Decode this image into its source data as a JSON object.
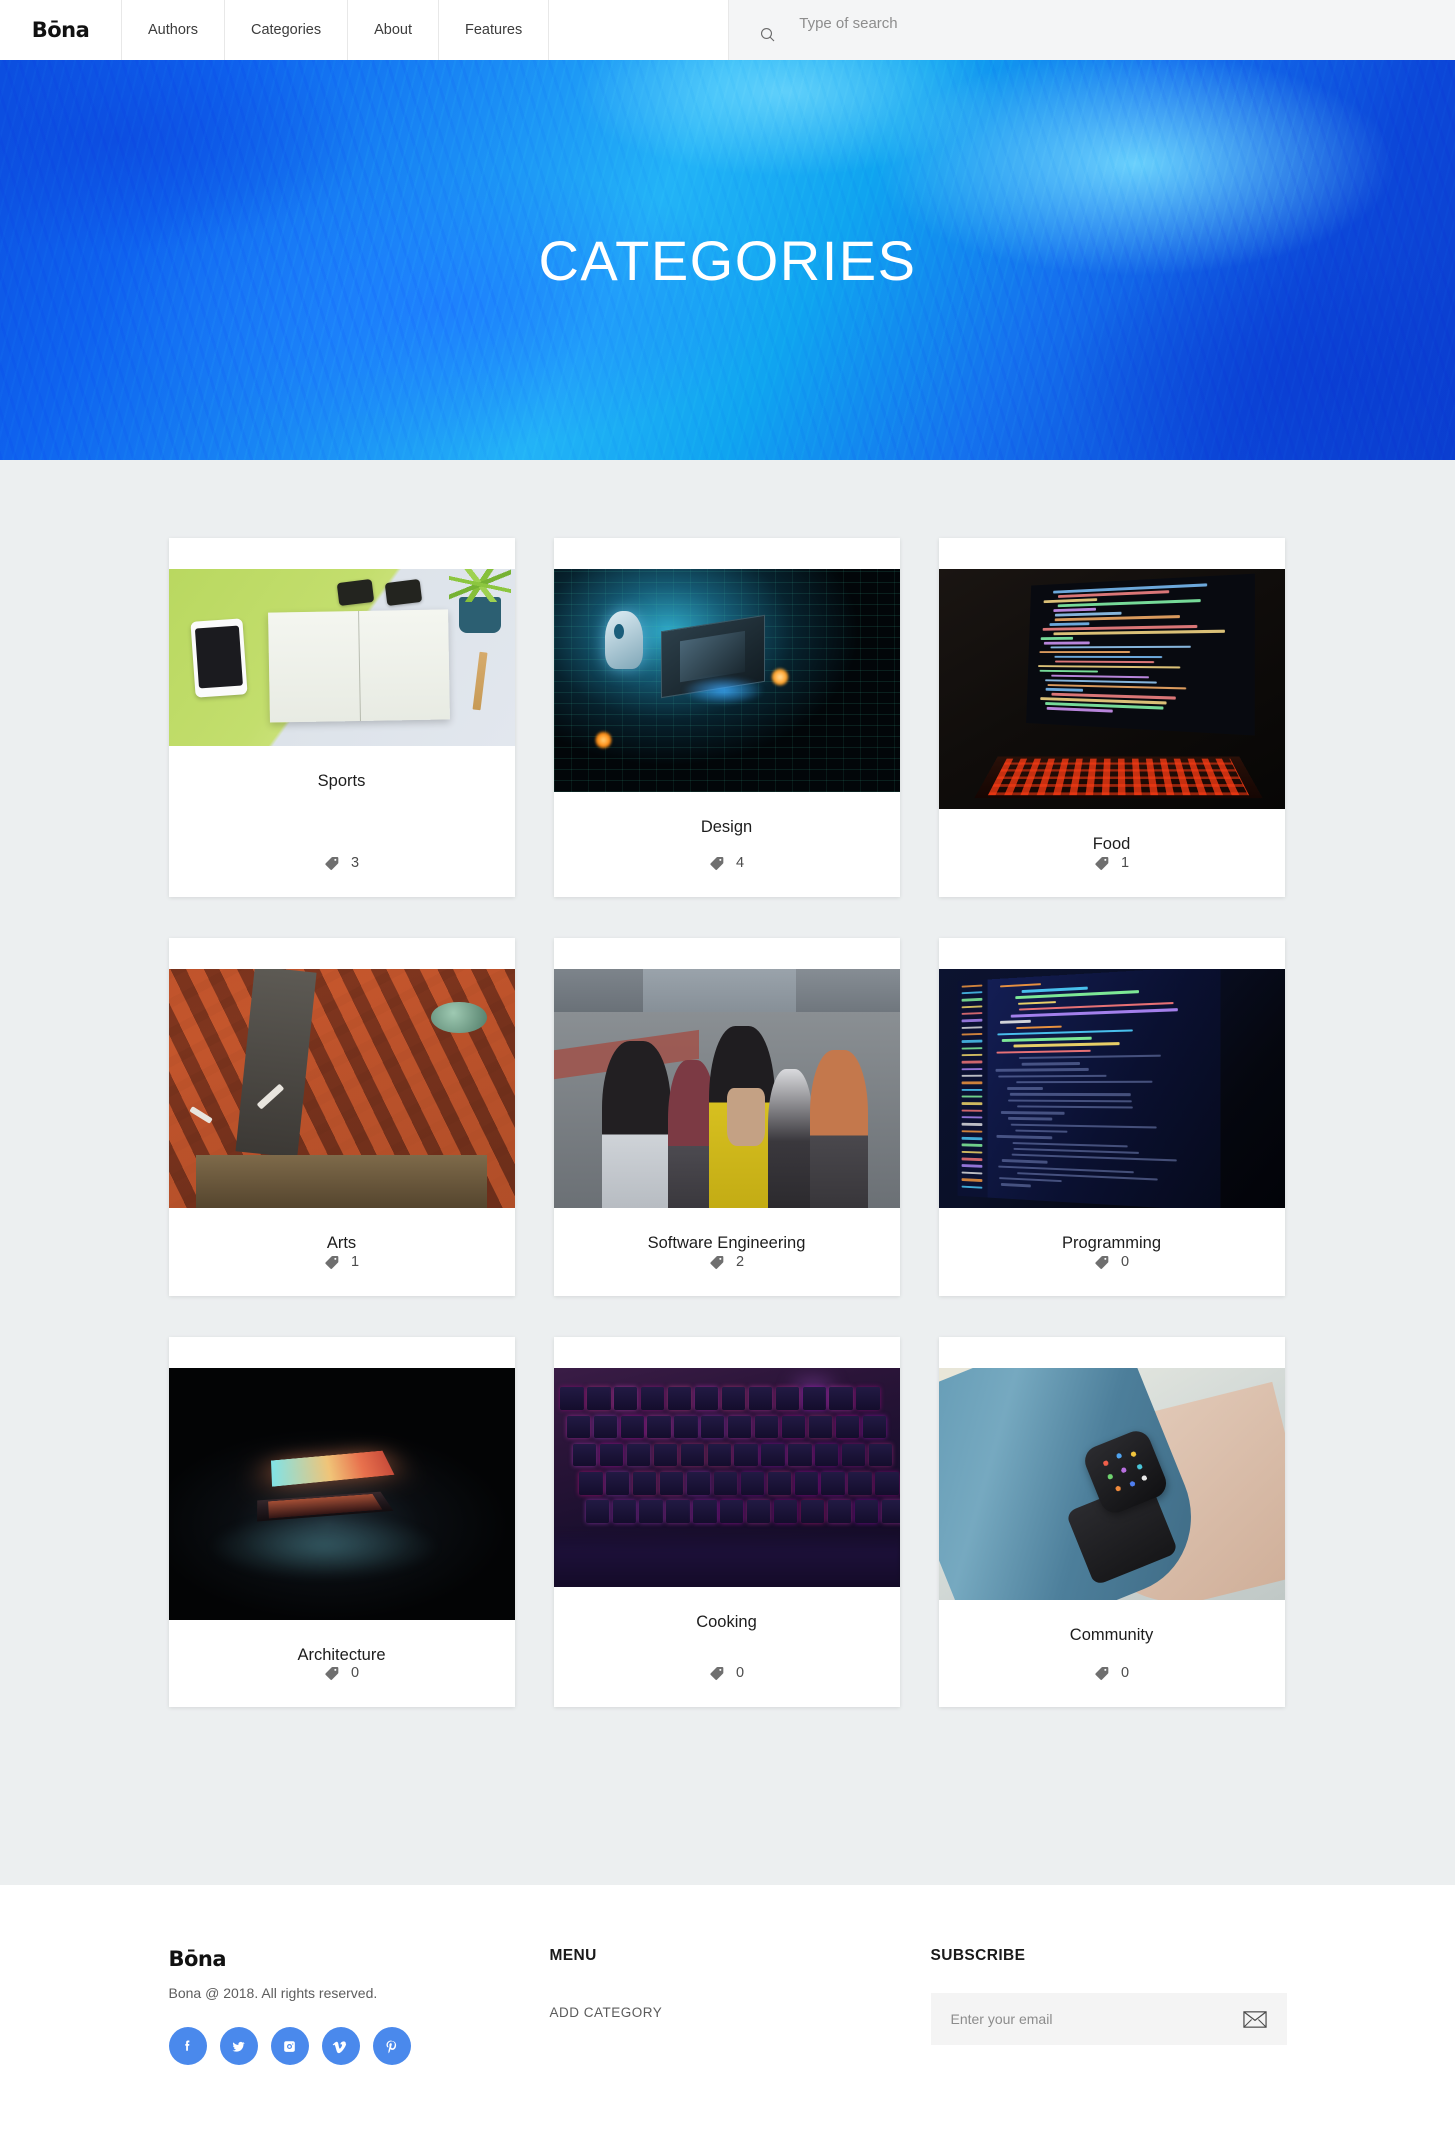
{
  "header": {
    "logo": "Bōna",
    "nav": [
      {
        "label": "Authors"
      },
      {
        "label": "Categories"
      },
      {
        "label": "About"
      },
      {
        "label": "Features"
      }
    ],
    "search": {
      "placeholder": "Type of search",
      "value": "",
      "icon": "search-icon"
    }
  },
  "hero": {
    "title": "CATEGORIES"
  },
  "categories": [
    {
      "title": "Sports",
      "count": "3",
      "thumb": "notebook-flatlay",
      "thumb_height": 177,
      "tag_icon": "tag-icon"
    },
    {
      "title": "Design",
      "count": "4",
      "thumb": "circuit-board",
      "thumb_height": 223,
      "tag_icon": "tag-icon"
    },
    {
      "title": "Food",
      "count": "1",
      "thumb": "laptop-code-dark",
      "thumb_height": 240,
      "tag_icon": "tag-icon"
    },
    {
      "title": "Arts",
      "count": "1",
      "thumb": "aerial-rooftops",
      "thumb_height": 239,
      "tag_icon": "tag-icon"
    },
    {
      "title": "Software Engineering",
      "count": "2",
      "thumb": "crowd-street",
      "thumb_height": 239,
      "tag_icon": "tag-icon"
    },
    {
      "title": "Programming",
      "count": "0",
      "thumb": "code-screen",
      "thumb_height": 239,
      "tag_icon": "tag-icon"
    },
    {
      "title": "Architecture",
      "count": "0",
      "thumb": "glowing-laptop",
      "thumb_height": 252,
      "tag_icon": "tag-icon"
    },
    {
      "title": "Cooking",
      "count": "0",
      "thumb": "rgb-keyboard",
      "thumb_height": 219,
      "tag_icon": "tag-icon"
    },
    {
      "title": "Community",
      "count": "0",
      "thumb": "smartwatch-wrist",
      "thumb_height": 232,
      "tag_icon": "tag-icon"
    }
  ],
  "footer": {
    "logo": "Bōna",
    "copyright": "Bona @ 2018. All rights reserved.",
    "socials": [
      {
        "name": "facebook-icon"
      },
      {
        "name": "twitter-icon"
      },
      {
        "name": "instagram-icon"
      },
      {
        "name": "vimeo-icon"
      },
      {
        "name": "pinterest-icon"
      }
    ],
    "menu_heading": "MENU",
    "menu_links": [
      {
        "label": "ADD CATEGORY"
      }
    ],
    "subscribe_heading": "SUBSCRIBE",
    "subscribe": {
      "placeholder": "Enter your email",
      "value": "",
      "submit_icon": "envelope-icon"
    }
  },
  "colors": {
    "accent": "#4a89ec",
    "page_bg": "#eceff0",
    "hero_blue": "#1a8bf5"
  }
}
